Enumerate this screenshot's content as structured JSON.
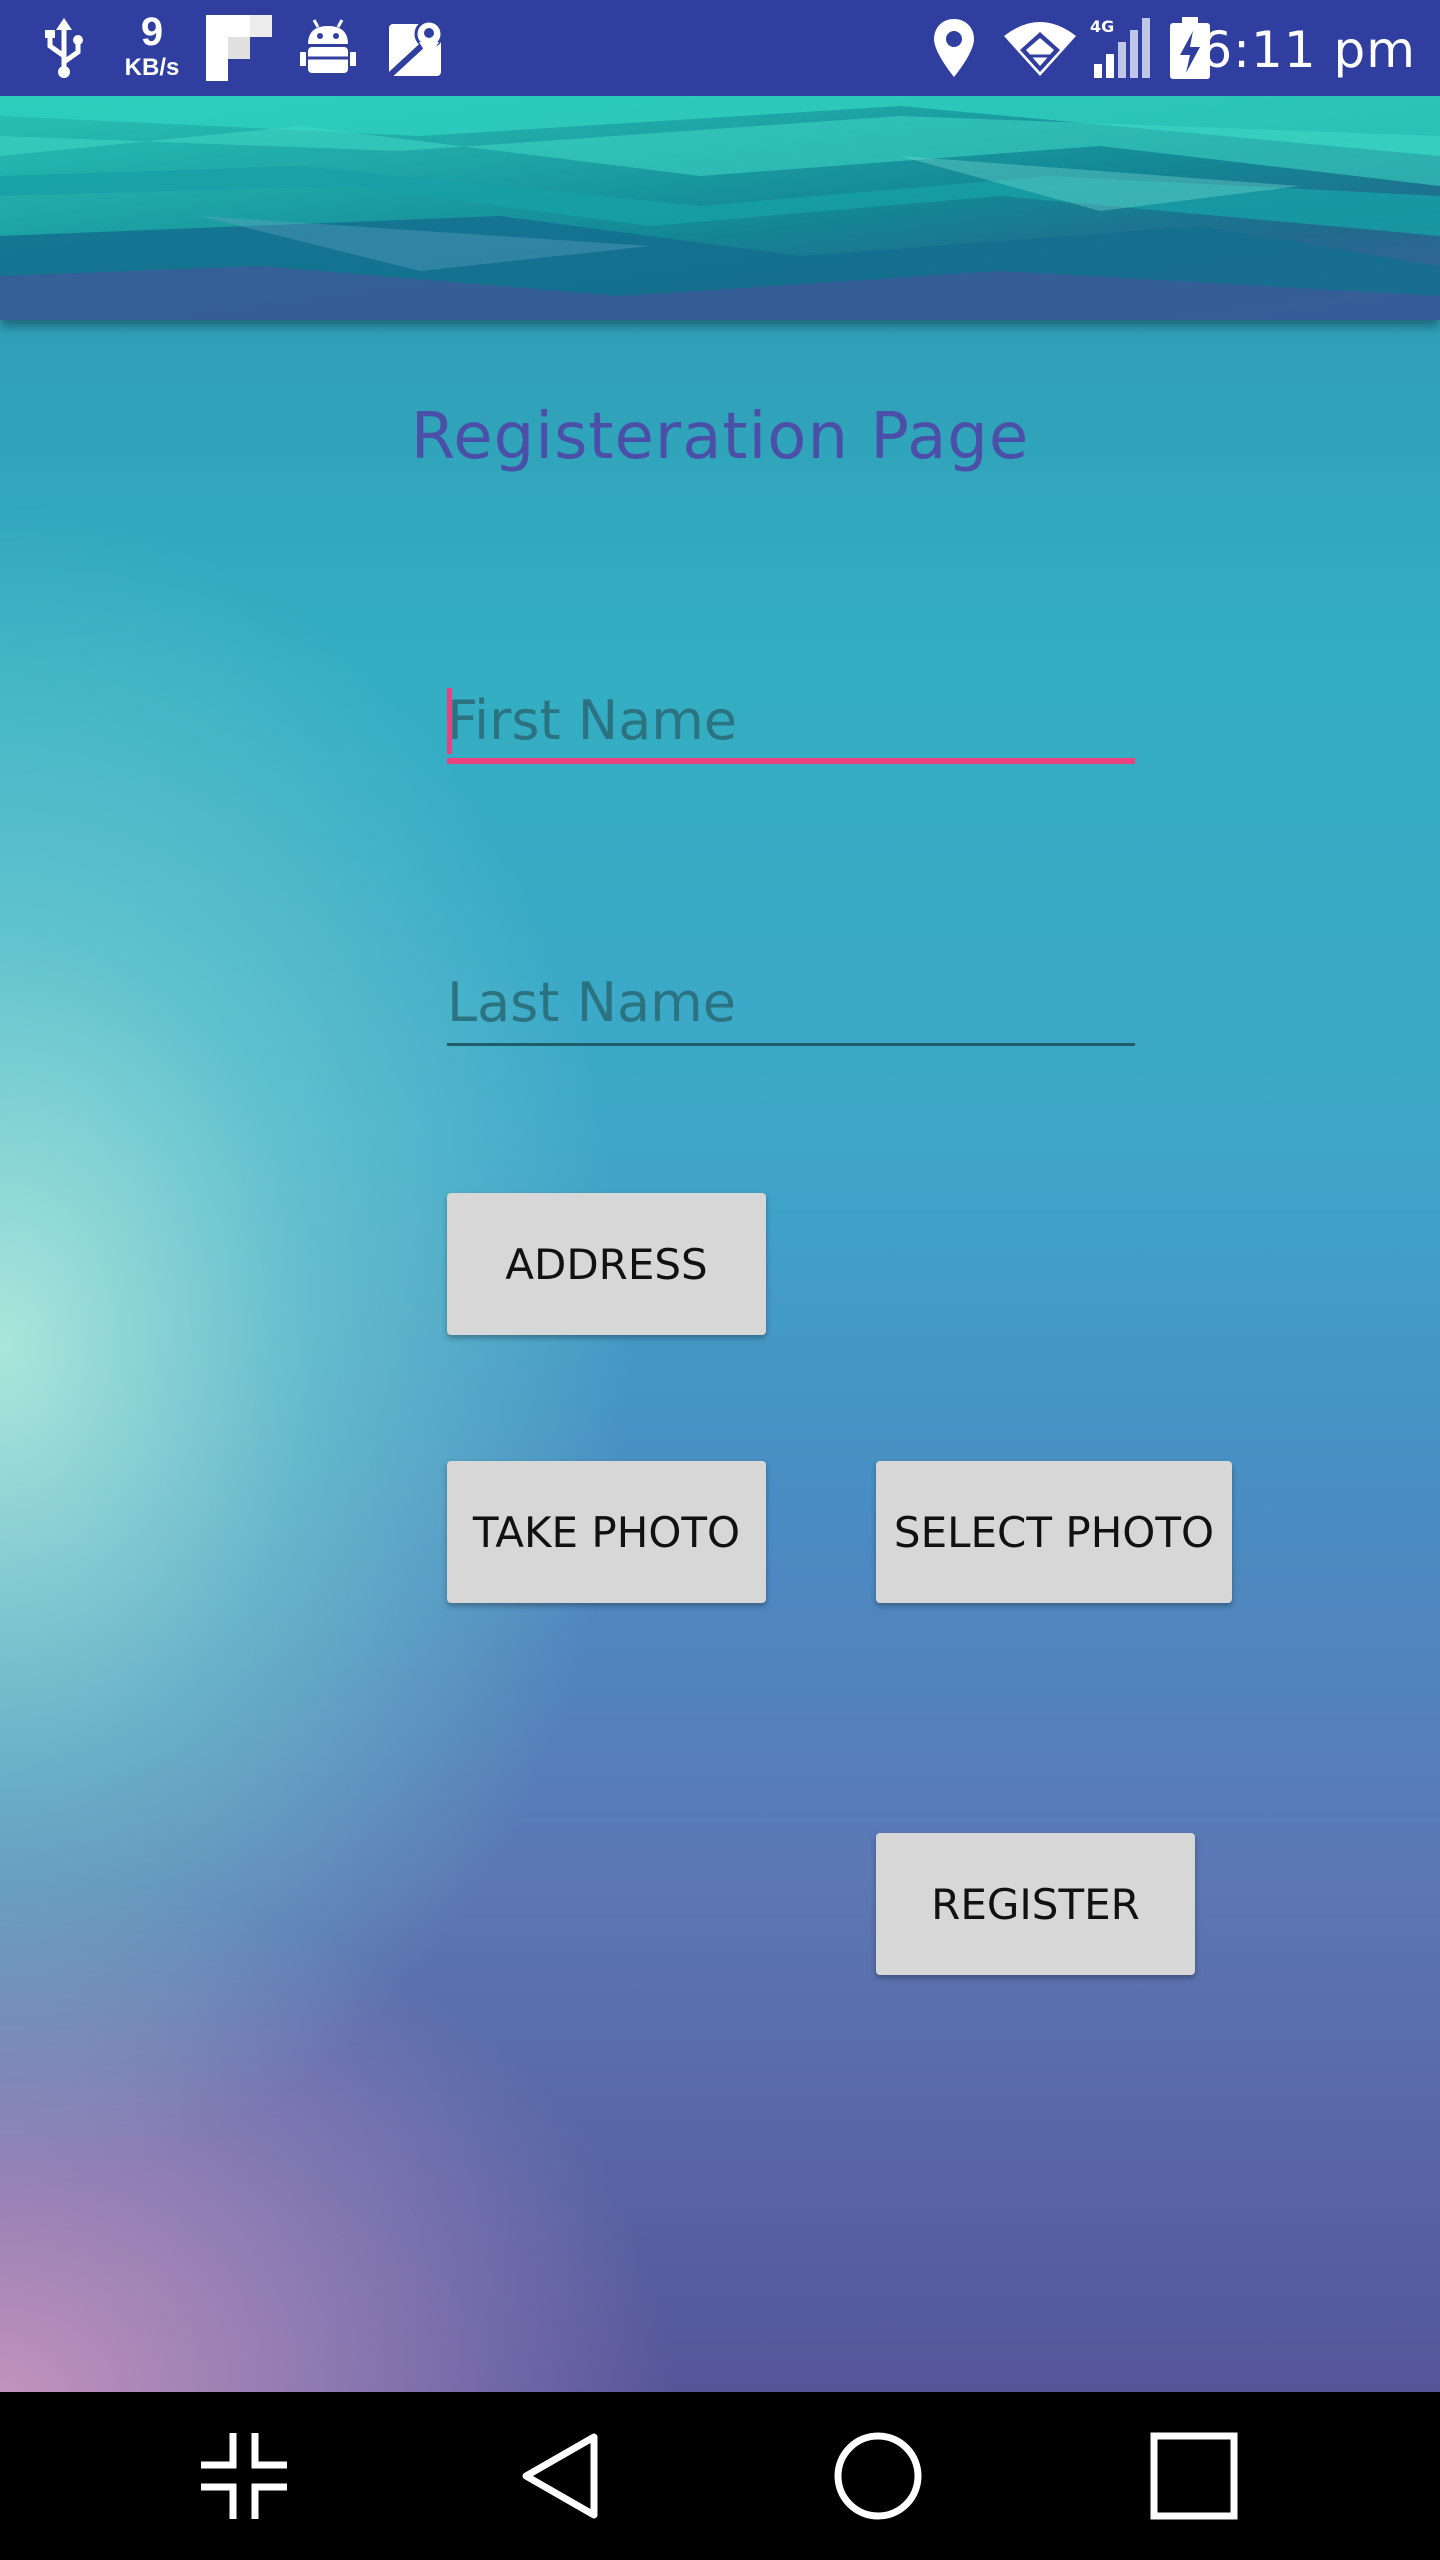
{
  "status_bar": {
    "network_speed_value": "9",
    "network_speed_unit": "KB/s",
    "time": "6:11 pm",
    "network_type": "4G",
    "icons": [
      "usb-icon",
      "network-speed",
      "flipboard-icon",
      "android-debug-icon",
      "maps-icon",
      "location-icon",
      "wifi-icon",
      "signal-icon",
      "battery-charging-icon"
    ]
  },
  "page": {
    "title": "Registeration Page"
  },
  "form": {
    "first_name_placeholder": "First Name",
    "first_name_value": "",
    "last_name_placeholder": "Last Name",
    "last_name_value": "",
    "address_label": "ADDRESS",
    "take_photo_label": "TAKE PHOTO",
    "select_photo_label": "SELECT PHOTO",
    "register_label": "REGISTER"
  },
  "nav_bar": {
    "buttons": [
      "collapse-icon",
      "back-icon",
      "home-icon",
      "recents-icon"
    ]
  },
  "colors": {
    "status_bar": "#303f9f",
    "title": "#4b4fa7",
    "accent": "#e8437e",
    "button_bg": "#d7d7d7",
    "nav_bar": "#000000"
  }
}
